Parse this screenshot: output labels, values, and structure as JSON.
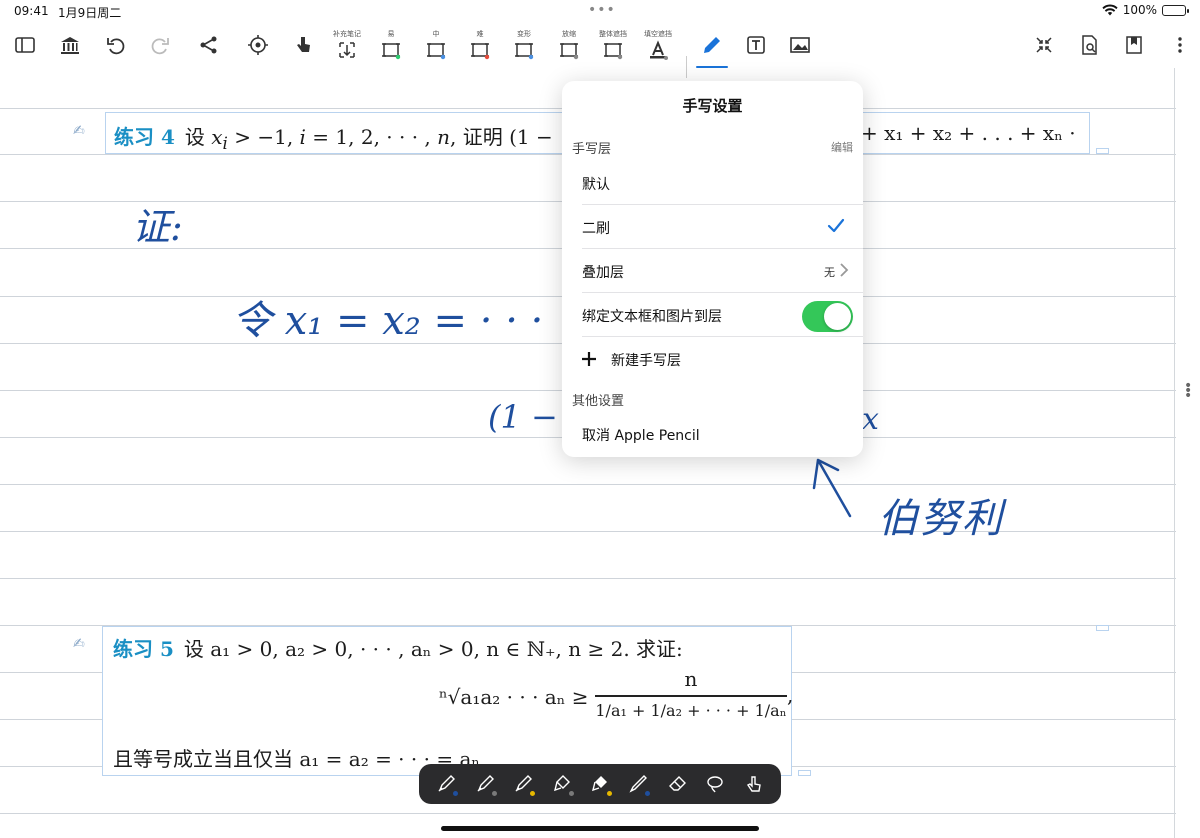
{
  "status": {
    "time": "09:41",
    "date": "1月9日周二",
    "battery": "100%"
  },
  "toolbar": {
    "captions": {
      "supplement": "补充笔记",
      "easy": "易",
      "medium": "中",
      "hard": "难",
      "variant": "变形",
      "collapse": "放缩",
      "whole_mask": "整体遮挡",
      "blank_mask": "填空遮挡"
    },
    "icons": [
      "sidebar-icon",
      "library-icon",
      "undo-icon",
      "redo-icon",
      "mindmap-icon",
      "review-icon",
      "hand-pointer-icon",
      "supplement-note-icon",
      "card-easy-icon",
      "card-medium-icon",
      "card-hard-icon",
      "card-variant-icon",
      "card-collapse-icon",
      "whole-mask-icon",
      "blank-mask-icon",
      "pen-icon",
      "textbox-icon",
      "image-icon",
      "fullscreen-icon",
      "search-doc-icon",
      "bookmark-icon",
      "more-icon"
    ]
  },
  "exercise4": {
    "label": "练习 4",
    "text_a": "设 ",
    "text_b": " > −1, ",
    "text_c": " = 1, 2, · · · , ",
    "text_d": ", 证明 (1 −",
    "tail": "+ x₁ + x₂ + . . . + xₙ ·"
  },
  "exercise5": {
    "label": "练习 5",
    "line1": "设 a₁ > 0, a₂ > 0, · · · , aₙ > 0, n ∈ ℕ₊, n ≥ 2. 求证:",
    "root": "ⁿ√a₁a₂ · · · aₙ  ≥",
    "numerator": "n",
    "denominator": "1/a₁ + 1/a₂ + · · · + 1/aₙ",
    "comma": ",",
    "line3": "且等号成立当且仅当 a₁ = a₂ = · · · = aₙ"
  },
  "handwriting": {
    "proof": "证:",
    "let": "令 x₁ = x₂ = · · ·",
    "bracket": "(1 −",
    "x": "x",
    "bernoulli": "伯努利"
  },
  "popover": {
    "title": "手写设置",
    "section_layers": "手写层",
    "edit": "编辑",
    "default_layer": "默认",
    "second_brush": "二刷",
    "overlay_layer": "叠加层",
    "overlay_value": "无",
    "bind_label": "绑定文本框和图片到层",
    "bind_on": true,
    "new_layer": "新建手写层",
    "section_other": "其他设置",
    "cancel_pencil": "取消 Apple Pencil"
  },
  "pen_tools": {
    "colors": [
      "#1f4f9e",
      "#7a7a7a",
      "#e6b800",
      "#7a7a7a",
      "#e6b800",
      "#1f4f9e"
    ]
  },
  "colors": {
    "accent": "#1a73d9",
    "toggle_on": "#34c759",
    "exercise_label": "#1a8fc4",
    "ink": "#1f4f9e"
  }
}
